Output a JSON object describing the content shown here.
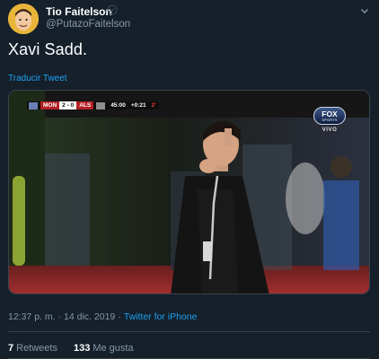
{
  "author": {
    "name": "Tio Faitelson",
    "handle": "@PutazoFaitelson",
    "verified_icon": "verified-badge-icon",
    "menu_icon": "chevron-down-icon",
    "avatar_color": "#e8b53a"
  },
  "tweet": {
    "text": "Xavi Sadd.",
    "translate_label": "Traducir Tweet"
  },
  "media": {
    "scorebug": {
      "team_home": "MON",
      "score": "2 - 0",
      "team_away": "ALS",
      "clock": "45:00",
      "added_time": "+0:21",
      "period": "2'"
    },
    "broadcaster": {
      "logo_word": "FOX",
      "logo_sub": "SPORTS",
      "live_label": "VIVO"
    }
  },
  "meta": {
    "time": "12:37 p. m.",
    "date": "14 dic. 2019",
    "separator": "·",
    "source": "Twitter for iPhone"
  },
  "stats": {
    "retweets_count": "7",
    "retweets_label": "Retweets",
    "likes_count": "133",
    "likes_label": "Me gusta"
  },
  "colors": {
    "background": "#15202b",
    "accent": "#1da1f2",
    "secondary_text": "#8899a6",
    "divider": "#38444d"
  }
}
